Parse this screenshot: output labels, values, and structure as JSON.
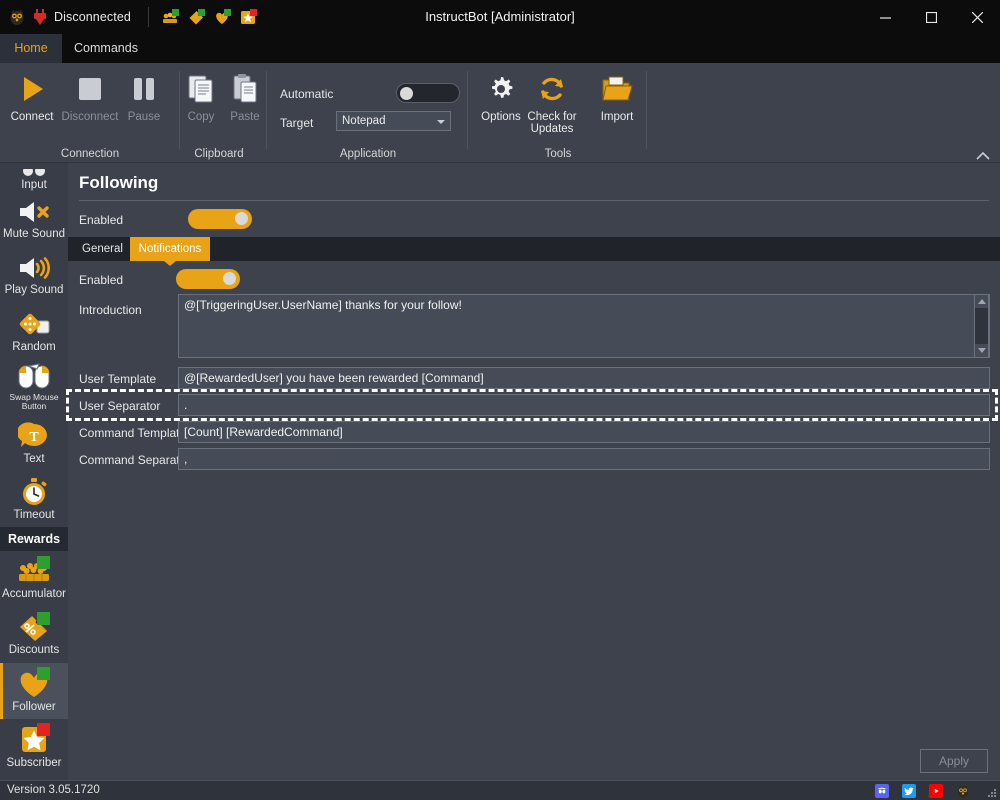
{
  "titlebar": {
    "connection_status": "Disconnected",
    "window_title": "InstructBot [Administrator]",
    "owl_icon": "owl-logo-icon",
    "plug_icon": "plug-disconnected-icon",
    "quick_icons": [
      {
        "name": "accumulator-mini-icon",
        "badge": "#2e9e2e"
      },
      {
        "name": "discounts-mini-icon",
        "badge": "#2e9e2e"
      },
      {
        "name": "follower-mini-icon",
        "badge": "#2e9e2e"
      },
      {
        "name": "subscriber-mini-icon",
        "badge": "#e02424"
      }
    ],
    "minimize_label": "minimize-icon",
    "maximize_label": "maximize-icon",
    "close_label": "close-icon"
  },
  "ribbon_tabs": [
    {
      "label": "Home",
      "active": true
    },
    {
      "label": "Commands",
      "active": false
    }
  ],
  "ribbon": {
    "groups": [
      {
        "label": "Connection",
        "buttons": [
          {
            "label": "Connect",
            "icon": "play-triangle-icon",
            "enabled": true
          },
          {
            "label": "Disconnect",
            "icon": "stop-square-icon",
            "enabled": false
          },
          {
            "label": "Pause",
            "icon": "pause-bars-icon",
            "enabled": false
          }
        ]
      },
      {
        "label": "Clipboard",
        "buttons": [
          {
            "label": "Copy",
            "icon": "copy-pages-icon",
            "enabled": false
          },
          {
            "label": "Paste",
            "icon": "paste-clipboard-icon",
            "enabled": false
          }
        ]
      },
      {
        "label": "Application",
        "automatic_label": "Automatic",
        "automatic_on": false,
        "target_label": "Target",
        "target_value": "Notepad"
      },
      {
        "label": "Tools",
        "buttons": [
          {
            "label": "Options",
            "icon": "gear-icon",
            "enabled": true
          },
          {
            "label": "Check for Updates",
            "icon": "refresh-circular-icon",
            "enabled": true
          },
          {
            "label": "Import",
            "icon": "folder-open-icon",
            "enabled": true
          }
        ]
      }
    ],
    "collapse_icon": "chevron-up-icon"
  },
  "sidebar": {
    "items": [
      {
        "label": "Input",
        "icon": "input-icon",
        "type": "item",
        "clipped": true
      },
      {
        "label": "Mute Sound",
        "icon": "mute-speaker-icon",
        "type": "item"
      },
      {
        "label": "Play Sound",
        "icon": "play-speaker-icon",
        "type": "item"
      },
      {
        "label": "Random",
        "icon": "dice-icon",
        "type": "item"
      },
      {
        "label": "Swap Mouse Button",
        "icon": "swap-mouse-icon",
        "type": "item",
        "small": true
      },
      {
        "label": "Text",
        "icon": "text-bubble-icon",
        "type": "item"
      },
      {
        "label": "Timeout",
        "icon": "stopwatch-icon",
        "type": "item"
      },
      {
        "label": "Rewards",
        "type": "header"
      },
      {
        "label": "Accumulator",
        "icon": "crowd-icon",
        "type": "item",
        "badge": "#2e9e2e"
      },
      {
        "label": "Discounts",
        "icon": "price-tag-icon",
        "type": "item",
        "badge": "#2e9e2e"
      },
      {
        "label": "Follower",
        "icon": "heart-icon",
        "type": "item",
        "badge": "#2e9e2e",
        "selected": true
      },
      {
        "label": "Subscriber",
        "icon": "star-icon",
        "type": "item",
        "badge": "#e02424"
      }
    ]
  },
  "panel": {
    "title": "Following",
    "enabled_label": "Enabled",
    "enabled_on": true,
    "tabs": [
      {
        "label": "General",
        "active": false
      },
      {
        "label": "Notifications",
        "active": true
      }
    ],
    "notifications": {
      "enabled_label": "Enabled",
      "enabled_on": true,
      "fields": [
        {
          "label": "Introduction",
          "value": "@[TriggeringUser.UserName] thanks for your follow!",
          "multiline": true
        },
        {
          "label": "User Template",
          "value": "@[RewardedUser] you have been rewarded [Command]",
          "multiline": false
        },
        {
          "label": "User Separator",
          "value": ".",
          "multiline": false,
          "highlighted": true
        },
        {
          "label": "Command Template",
          "value": "[Count] [RewardedCommand]",
          "multiline": false
        },
        {
          "label": "Command Separator",
          "value": ",",
          "multiline": false
        }
      ]
    },
    "apply_label": "Apply",
    "apply_enabled": false
  },
  "statusbar": {
    "version": "Version 3.05.1720",
    "links": [
      {
        "name": "discord-icon",
        "color": "#5865f2"
      },
      {
        "name": "twitter-icon",
        "color": "#1d9bf0"
      },
      {
        "name": "youtube-icon",
        "color": "#ff0000"
      },
      {
        "name": "instructbot-owl-icon",
        "color": "#e8a317"
      }
    ],
    "resize_grip": "resize-grip-icon"
  },
  "colors": {
    "accent": "#e8a317",
    "window_bg": "#3d424d",
    "titlebar_bg": "#0c0c0c",
    "sidebar_bg": "#383d47",
    "field_bg": "#454b57",
    "tabbar_bg": "#202329"
  }
}
